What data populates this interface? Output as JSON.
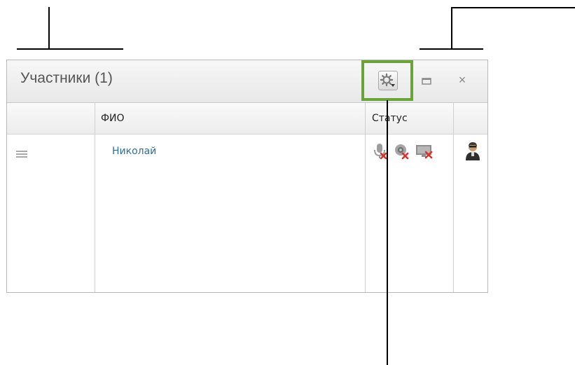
{
  "panel": {
    "title": "Участники (1)"
  },
  "header_buttons": {
    "settings_icon": "gear-dropdown-icon",
    "minimize_icon": "minimize-icon",
    "close_glyph": "×"
  },
  "grid": {
    "columns": [
      "",
      "ФИО",
      "Статус",
      ""
    ],
    "rows": [
      {
        "name": "Николай",
        "status_icons": [
          "microphone-off-icon",
          "camera-off-icon",
          "screen-share-off-icon"
        ],
        "role_icon": "user-avatar-icon"
      }
    ]
  },
  "colors": {
    "highlight": "#6aa33a",
    "link": "#2c6f9b",
    "off_badge": "#d9322b"
  }
}
